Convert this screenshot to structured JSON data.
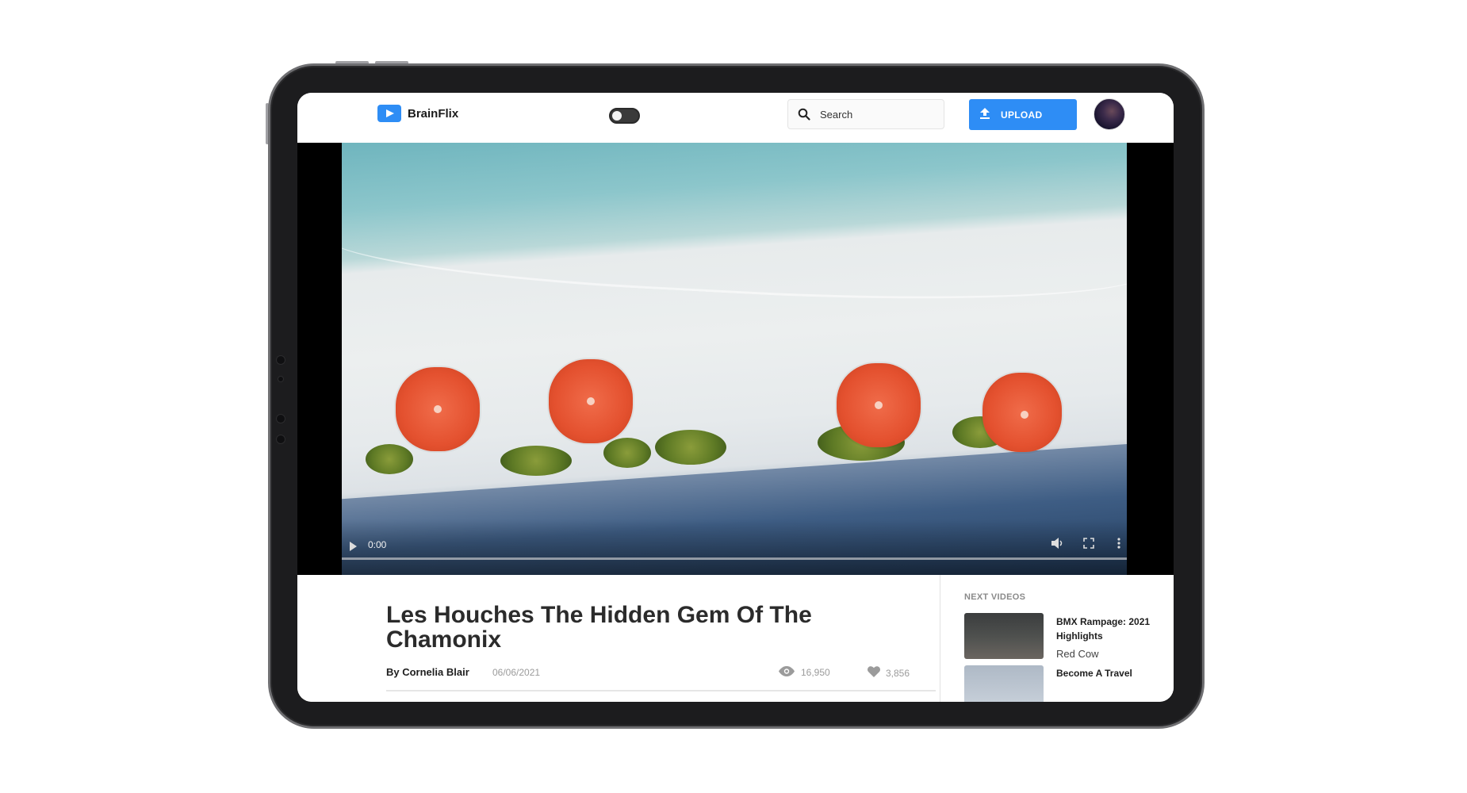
{
  "header": {
    "brand": "BrainFlix",
    "search_placeholder": "Search",
    "upload_label": "UPLOAD"
  },
  "player": {
    "current_time": "0:00"
  },
  "video": {
    "title": "Les Houches The Hidden Gem Of The Chamonix",
    "author": "By Cornelia Blair",
    "date": "06/06/2021",
    "views": "16,950",
    "likes": "3,856"
  },
  "next_videos": {
    "heading": "NEXT VIDEOS",
    "items": [
      {
        "title": "BMX Rampage: 2021 Highlights",
        "channel": "Red Cow"
      },
      {
        "title": "Become A Travel",
        "channel": ""
      }
    ]
  },
  "colors": {
    "accent": "#2e8df5",
    "text_dark": "#2b2b2b",
    "text_muted": "#9b9b9b"
  }
}
